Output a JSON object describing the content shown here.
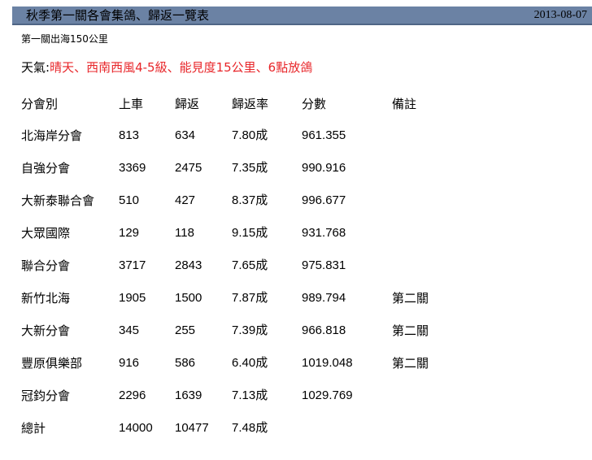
{
  "title": "秋季第一關各會集鴿、歸返一覽表",
  "date": "2013-08-07",
  "subtitle": "第一關出海150公里",
  "weather": {
    "label": "天氣:",
    "value": "晴天、西南西風4-5級、能見度15公里、6點放鴿"
  },
  "table": {
    "headers": [
      "分會別",
      "上車",
      "歸返",
      "歸返率",
      "分數",
      "備註"
    ],
    "rows": [
      [
        "北海岸分會",
        "813",
        "634",
        "7.80成",
        "961.355",
        ""
      ],
      [
        "自強分會",
        "3369",
        "2475",
        "7.35成",
        "990.916",
        ""
      ],
      [
        "大新泰聯合會",
        "510",
        "427",
        "8.37成",
        "996.677",
        ""
      ],
      [
        "大眾國際",
        "129",
        "118",
        "9.15成",
        "931.768",
        ""
      ],
      [
        "聯合分會",
        "3717",
        "2843",
        "7.65成",
        "975.831",
        ""
      ],
      [
        "新竹北海",
        "1905",
        "1500",
        "7.87成",
        "989.794",
        "第二關"
      ],
      [
        "大新分會",
        "345",
        "255",
        "7.39成",
        "966.818",
        "第二關"
      ],
      [
        "豐原俱樂部",
        "916",
        "586",
        "6.40成",
        "1019.048",
        "第二關"
      ],
      [
        "冠鈞分會",
        "2296",
        "1639",
        "7.13成",
        "1029.769",
        ""
      ],
      [
        "總計",
        "14000",
        "10477",
        "7.48成",
        "",
        ""
      ]
    ]
  }
}
